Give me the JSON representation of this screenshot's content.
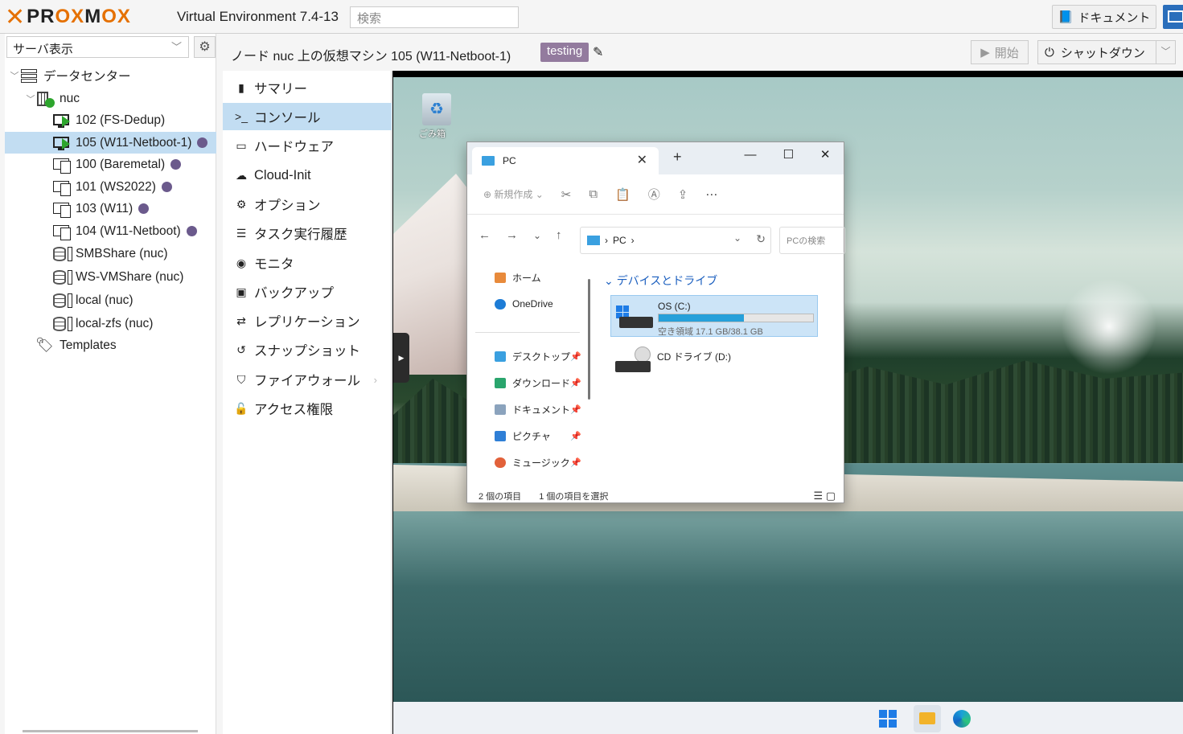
{
  "topbar": {
    "logo": "PROXMOX",
    "version": "Virtual Environment 7.4-13",
    "search_placeholder": "検索",
    "docs_label": "ドキュメント"
  },
  "tree": {
    "view_selector": "サーバ表示",
    "datacenter": "データセンター",
    "node": "nuc",
    "items": [
      {
        "label": "102 (FS-Dedup)",
        "kind": "vm-running"
      },
      {
        "label": "105 (W11-Netboot-1)",
        "kind": "vm-running",
        "selected": true,
        "tagged": true
      },
      {
        "label": "100 (Baremetal)",
        "kind": "template",
        "tagged": true
      },
      {
        "label": "101 (WS2022)",
        "kind": "template",
        "tagged": true
      },
      {
        "label": "103 (W11)",
        "kind": "template",
        "tagged": true
      },
      {
        "label": "104 (W11-Netboot)",
        "kind": "template",
        "tagged": true
      },
      {
        "label": "SMBShare (nuc)",
        "kind": "storage"
      },
      {
        "label": "WS-VMShare (nuc)",
        "kind": "storage"
      },
      {
        "label": "local (nuc)",
        "kind": "storage"
      },
      {
        "label": "local-zfs (nuc)",
        "kind": "storage"
      }
    ],
    "templates": "Templates",
    "tag_color": "#6b5a8c"
  },
  "header": {
    "title": "ノード nuc 上の仮想マシン 105 (W11-Netboot-1)",
    "tag": "testing",
    "start_label": "開始",
    "shutdown_label": "シャットダウン"
  },
  "menu": [
    {
      "label": "サマリー",
      "icon": "book-icon"
    },
    {
      "label": "コンソール",
      "icon": "terminal-icon",
      "selected": true
    },
    {
      "label": "ハードウェア",
      "icon": "desktop-icon"
    },
    {
      "label": "Cloud-Init",
      "icon": "cloud-icon"
    },
    {
      "label": "オプション",
      "icon": "gear-icon"
    },
    {
      "label": "タスク実行履歴",
      "icon": "list-icon"
    },
    {
      "label": "モニタ",
      "icon": "eye-icon"
    },
    {
      "label": "バックアップ",
      "icon": "floppy-icon"
    },
    {
      "label": "レプリケーション",
      "icon": "retweet-icon"
    },
    {
      "label": "スナップショット",
      "icon": "history-icon"
    },
    {
      "label": "ファイアウォール",
      "icon": "shield-icon",
      "submenu": true
    },
    {
      "label": "アクセス権限",
      "icon": "unlock-icon"
    }
  ],
  "console": {
    "recycle_bin": "ごみ箱",
    "explorer": {
      "tab_title": "PC",
      "new_label": "新規作成",
      "address": "PC",
      "search_placeholder": "PCの検索",
      "nav": {
        "home": "ホーム",
        "onedrive": "OneDrive",
        "desktop": "デスクトップ",
        "downloads": "ダウンロード",
        "documents": "ドキュメント",
        "pictures": "ピクチャ",
        "music": "ミュージック"
      },
      "group_header": "デバイスとドライブ",
      "drives": [
        {
          "name": "OS (C:)",
          "free_text": "空き領域 17.1 GB/38.1 GB",
          "used_fraction": 0.55
        },
        {
          "name": "CD ドライブ (D:)"
        }
      ],
      "status_items": "2 個の項目",
      "status_selected": "1 個の項目を選択"
    }
  }
}
